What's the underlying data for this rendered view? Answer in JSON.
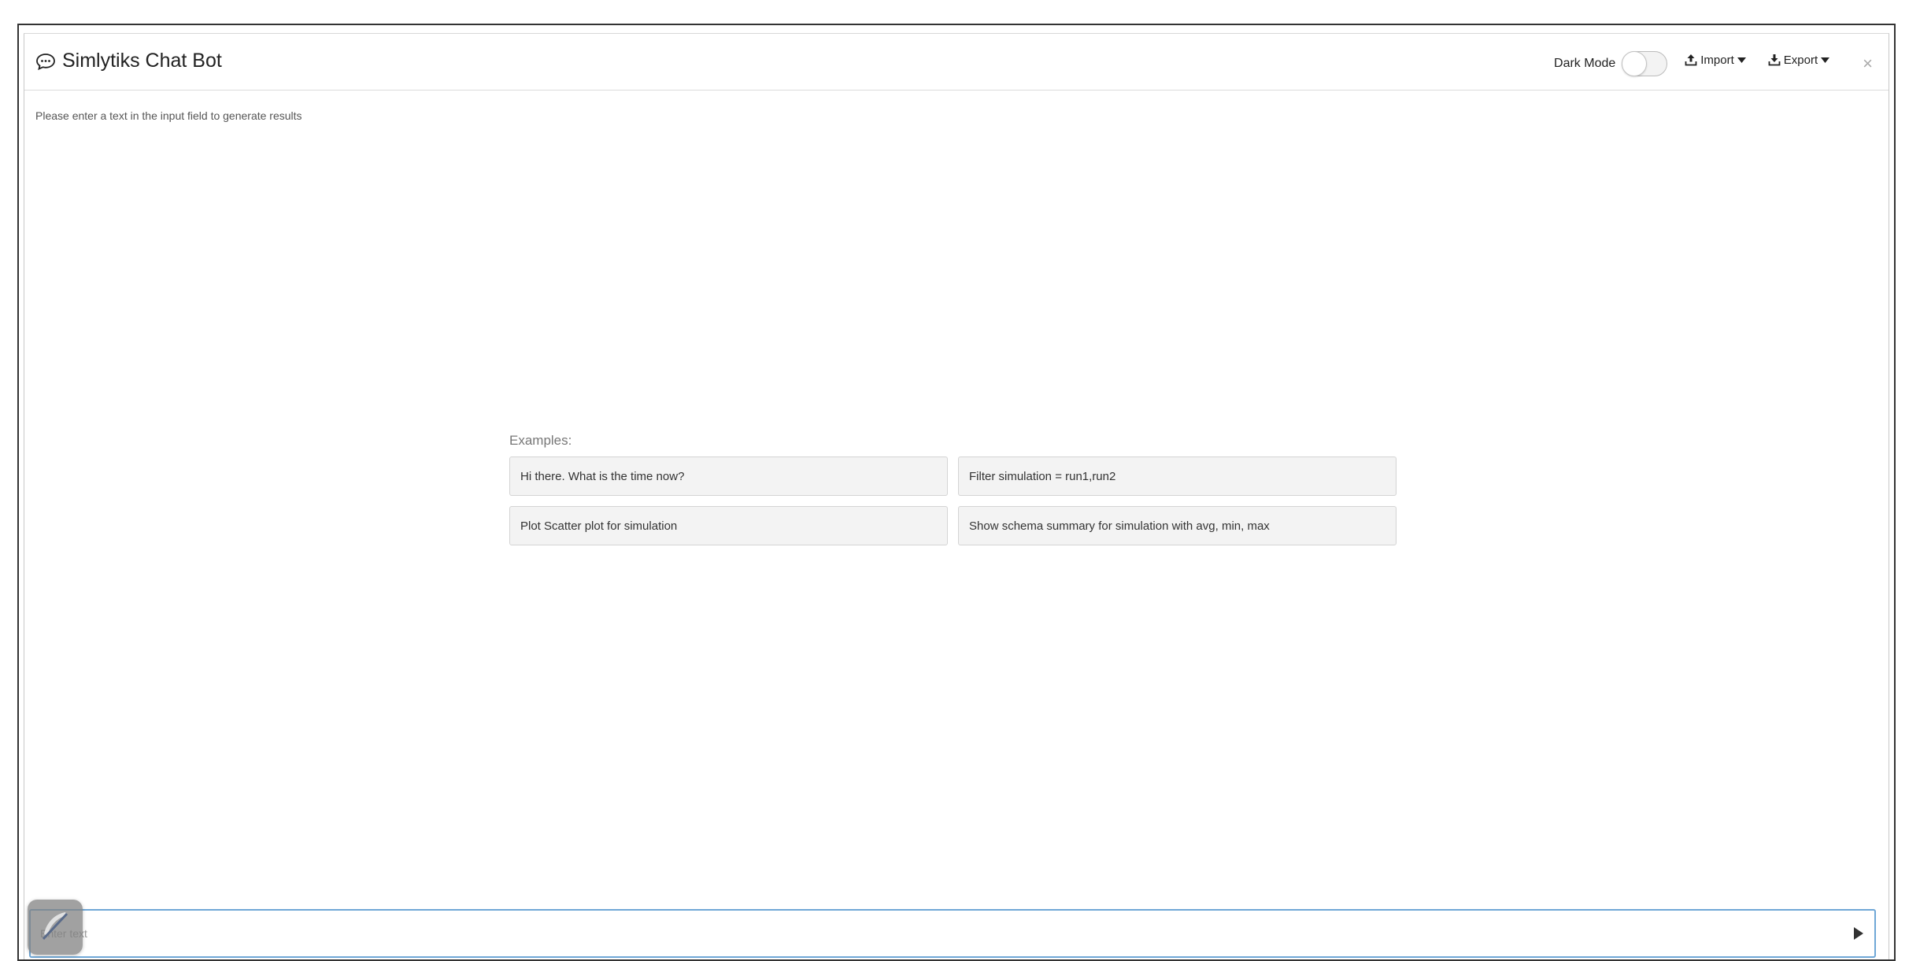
{
  "header": {
    "title": "Simlytiks Chat Bot",
    "dark_mode_label": "Dark Mode",
    "dark_mode_on": false,
    "import_label": "Import",
    "export_label": "Export",
    "close_symbol": "×"
  },
  "body": {
    "hint": "Please enter a text in the input field to generate results",
    "examples_label": "Examples:",
    "examples": [
      "Hi there. What is the time now?",
      "Filter simulation = run1,run2",
      "Plot Scatter plot for simulation",
      "Show schema summary for simulation with avg, min, max"
    ]
  },
  "input": {
    "placeholder": "Enter text",
    "value": ""
  },
  "icons": {
    "title": "chat-bubble-icon",
    "import": "upload-icon",
    "export": "download-icon",
    "dropdown": "caret-down-icon",
    "send": "play-triangle-icon",
    "floating": "feather-logo-icon"
  },
  "colors": {
    "input_border": "#6fa7d6",
    "example_bg": "#f3f3f3"
  }
}
